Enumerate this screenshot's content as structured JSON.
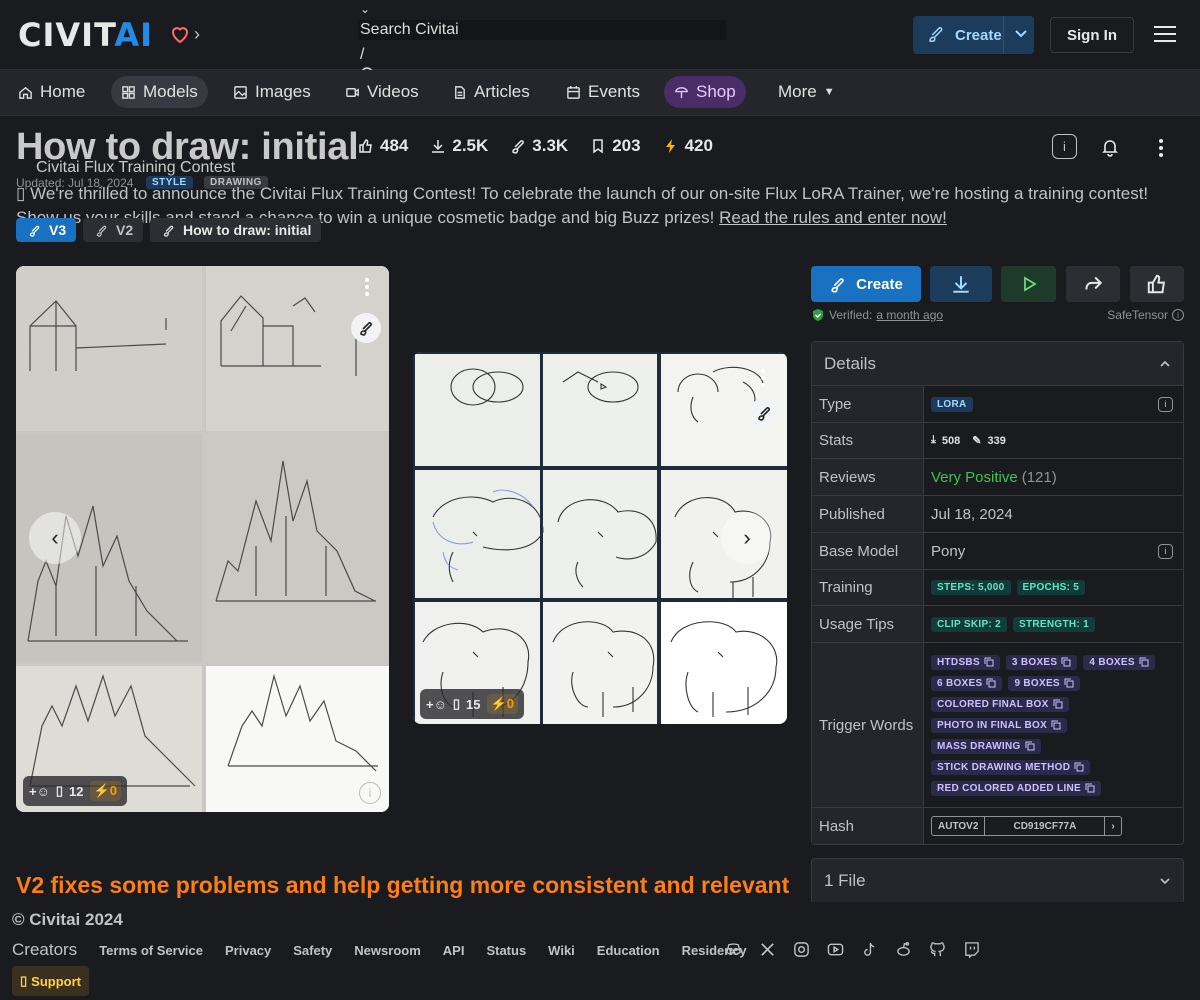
{
  "header": {
    "logo_main": "CIVIT",
    "logo_accent": "AI",
    "search_placeholder": "Search Civitai",
    "search_slash": "/",
    "create_label": "Create",
    "signin_label": "Sign In"
  },
  "nav": {
    "items": [
      {
        "label": "Home",
        "icon": "home-icon"
      },
      {
        "label": "Models",
        "icon": "grid-icon"
      },
      {
        "label": "Images",
        "icon": "photo-icon"
      },
      {
        "label": "Videos",
        "icon": "video-icon"
      },
      {
        "label": "Articles",
        "icon": "file-icon"
      },
      {
        "label": "Events",
        "icon": "calendar-icon"
      },
      {
        "label": "Shop",
        "icon": "shop-icon"
      }
    ],
    "more_label": "More"
  },
  "model": {
    "title": "How to draw: initial",
    "stats": {
      "likes": "484",
      "downloads": "2.5K",
      "generations": "3.3K",
      "bookmarks": "203",
      "buzz": "420"
    },
    "contest_title": "Civitai Flux Training Contest",
    "updated": "Updated: Jul 18, 2024",
    "tags": [
      "STYLE",
      "DRAWING"
    ],
    "banner_text": "We're thrilled to announce the Civitai Flux Training Contest! To celebrate the launch of our on-site Flux LoRA Trainer, we're hosting a training contest! Show us your skills and stand a chance to win a unique cosmetic badge and big Buzz prizes!",
    "banner_link": "Read the rules and enter now!",
    "versions": [
      "V3",
      "V2",
      "How to draw: initial"
    ]
  },
  "gallery": {
    "card1": {
      "comments": "12",
      "buzz": "0"
    },
    "card2": {
      "comments": "15",
      "buzz": "0"
    }
  },
  "actions": {
    "create_label": "Create",
    "verified_label": "Verified:",
    "verified_time": "a month ago",
    "format": "SafeTensor"
  },
  "details": {
    "heading": "Details",
    "type_label": "Type",
    "type_value": "LORA",
    "stats_label": "Stats",
    "stats_downloads": "508",
    "stats_generations": "339",
    "reviews_label": "Reviews",
    "reviews_value": "Very Positive",
    "reviews_count": "(121)",
    "published_label": "Published",
    "published_value": "Jul 18, 2024",
    "base_label": "Base Model",
    "base_value": "Pony",
    "training_label": "Training",
    "training_steps": "STEPS: 5,000",
    "training_epochs": "EPOCHS: 5",
    "usage_label": "Usage Tips",
    "usage_clip": "CLIP SKIP: 2",
    "usage_strength": "STRENGTH: 1",
    "trigger_label": "Trigger Words",
    "trigger_words": [
      "HTDSBS",
      "3 BOXES",
      "4 BOXES",
      "6 BOXES",
      "9 BOXES",
      "COLORED FINAL BOX",
      "PHOTO IN FINAL BOX",
      "MASS DRAWING",
      "STICK DRAWING METHOD",
      "RED COLORED ADDED LINE"
    ],
    "hash_label": "Hash",
    "hash_type": "AUTOV2",
    "hash_value": "CD919CF77A"
  },
  "files_label": "1 File",
  "v2_heading": "V2 fixes some problems and help getting more consistent and relevant",
  "footer": {
    "copyright": "© Civitai 2024",
    "creators": "Creators",
    "links": [
      "Terms of Service",
      "Privacy",
      "Safety",
      "Newsroom",
      "API",
      "Status",
      "Wiki",
      "Education",
      "Residency"
    ],
    "support": "Support"
  },
  "colors": {
    "accent": "#228be6",
    "shop": "#be4bdb",
    "heading_orange": "#fd7e14",
    "positive": "#40c057"
  }
}
